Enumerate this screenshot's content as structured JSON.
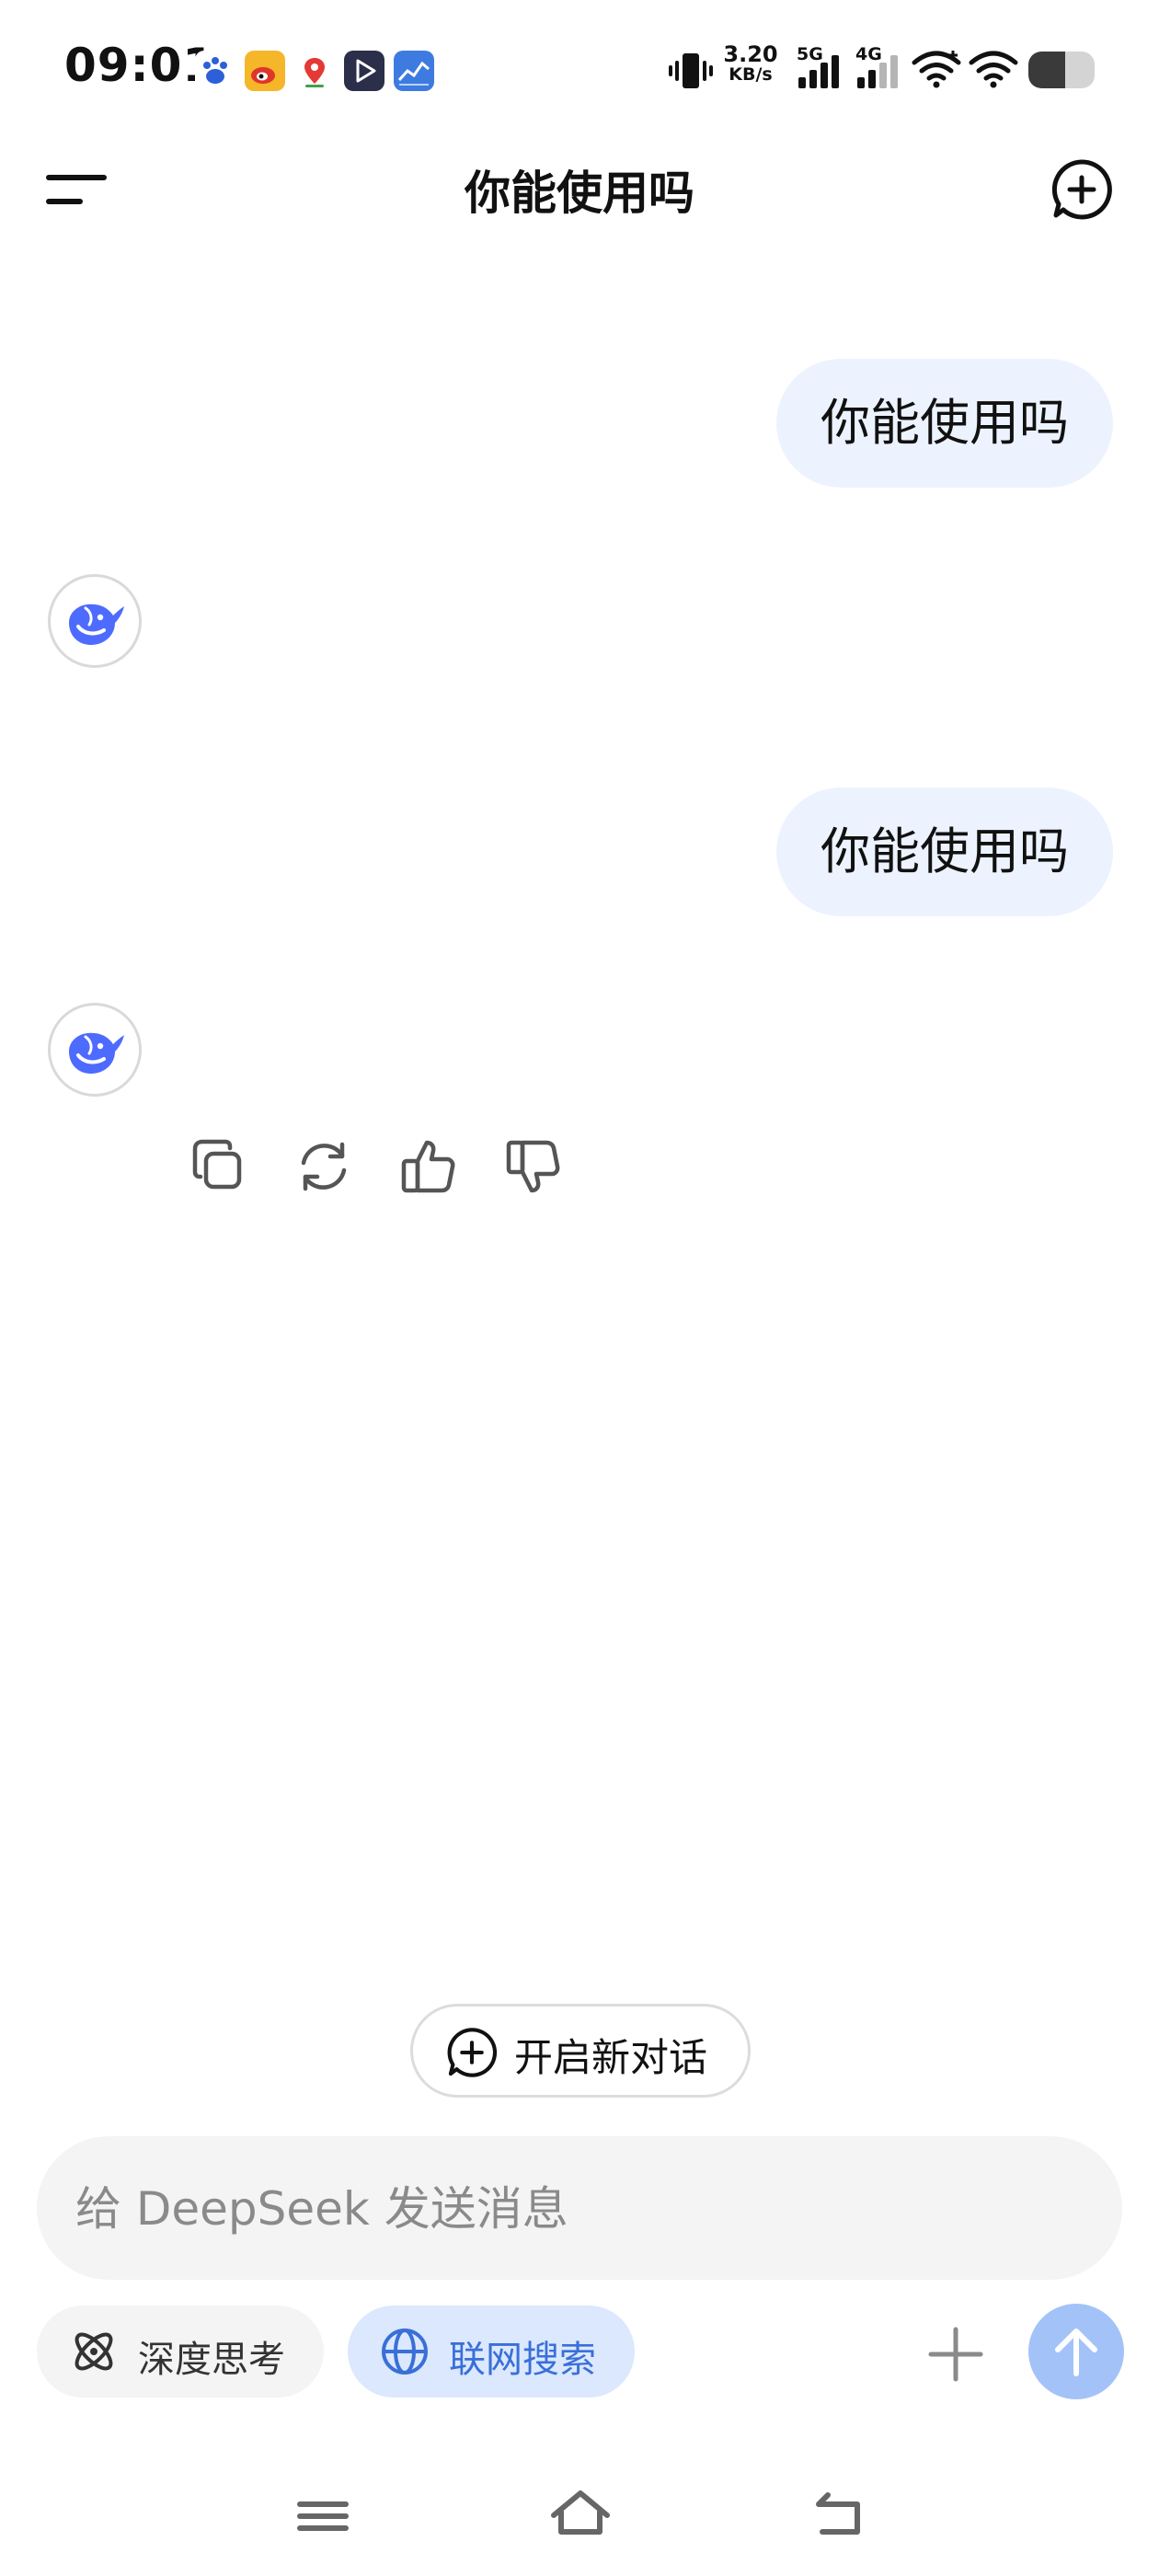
{
  "status_bar": {
    "time": "09:01",
    "app_icons": [
      "baidu-icon",
      "weibo-icon",
      "maps-icon",
      "video-icon",
      "stocks-icon"
    ],
    "net_speed_value": "3.20",
    "net_speed_unit": "KB/s",
    "network_1": "5G",
    "network_2": "4G",
    "battery_level": 0.55
  },
  "header": {
    "title": "你能使用吗"
  },
  "chat": {
    "messages": [
      {
        "role": "user",
        "text": "你能使用吗"
      },
      {
        "role": "assistant",
        "text": ""
      },
      {
        "role": "user",
        "text": "你能使用吗"
      },
      {
        "role": "assistant",
        "text": ""
      }
    ],
    "actions": [
      "copy-icon",
      "regenerate-icon",
      "thumbs-up-icon",
      "thumbs-down-icon"
    ]
  },
  "new_dialog": {
    "label": "开启新对话"
  },
  "composer": {
    "placeholder": "给 DeepSeek 发送消息",
    "value": "",
    "deep_think_label": "深度思考",
    "web_search_label": "联网搜索"
  },
  "colors": {
    "user_bubble": "#edf3fe",
    "brand_blue": "#4d6bfe",
    "search_pill_bg": "#dbe8fd",
    "search_pill_text": "#3a6fd8",
    "send_button": "#a3c3f8"
  }
}
